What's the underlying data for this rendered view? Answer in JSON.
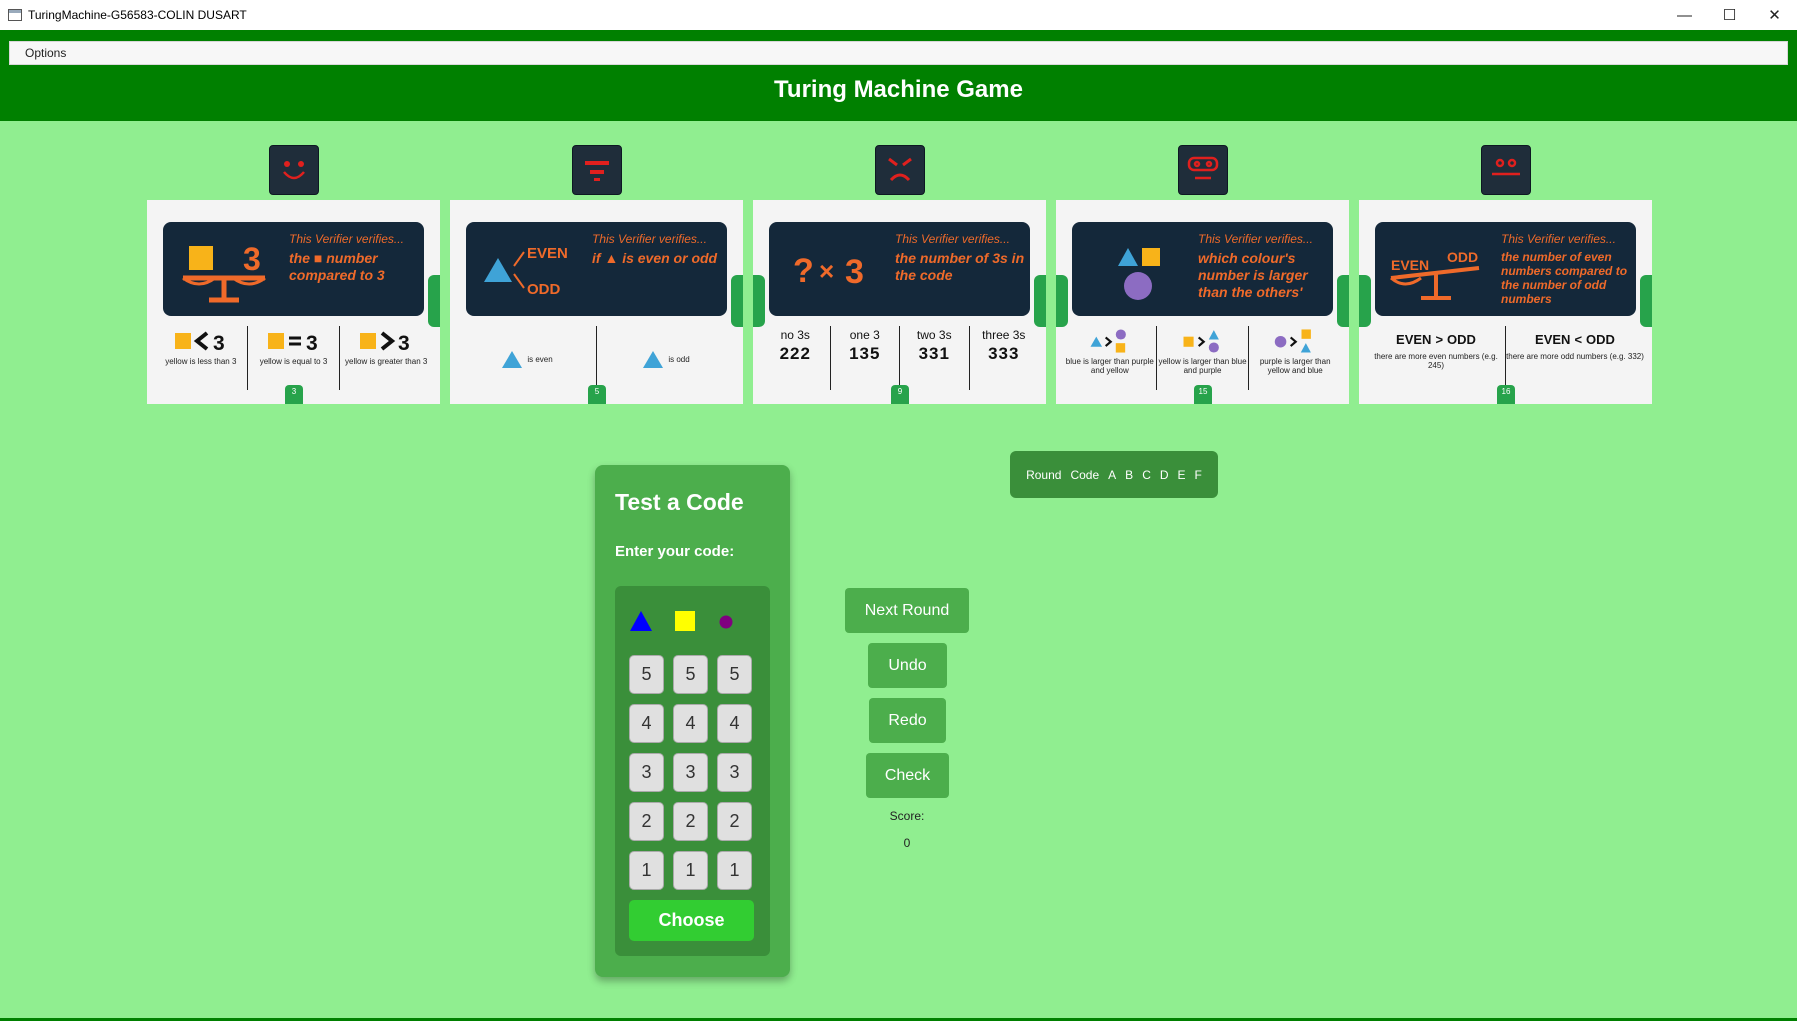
{
  "window": {
    "title": "TuringMachine-G56583-COLIN DUSART",
    "minimize": "—",
    "maximize": "☐",
    "close": "✕"
  },
  "menu": {
    "options": "Options"
  },
  "header": {
    "title": "Turing Machine Game"
  },
  "colors": {
    "accent": "#008000",
    "background": "#90ee90",
    "panel": "#4cae4c",
    "choose": "#32cd32",
    "card_text": "#ef6a2a"
  },
  "cards": [
    {
      "number": "3",
      "verifies": "This Verifier verifies...",
      "desc": "the ■ number compared to 3",
      "options": [
        {
          "caption": "yellow is less than 3"
        },
        {
          "caption": "yellow is equal to 3"
        },
        {
          "caption": "yellow is greater than 3"
        }
      ]
    },
    {
      "number": "5",
      "verifies": "This Verifier verifies...",
      "desc": "if ▲ is even or odd",
      "illus_even": "EVEN",
      "illus_odd": "ODD",
      "options": [
        {
          "caption": "is even"
        },
        {
          "caption": "is odd"
        }
      ]
    },
    {
      "number": "9",
      "verifies": "This Verifier verifies...",
      "desc": "the number of 3s in the code",
      "options": [
        {
          "top": "no 3s",
          "value": "222"
        },
        {
          "top": "one 3",
          "value": "135"
        },
        {
          "top": "two 3s",
          "value": "331"
        },
        {
          "top": "three 3s",
          "value": "333"
        }
      ]
    },
    {
      "number": "15",
      "verifies": "This Verifier verifies...",
      "desc": "which colour's number is larger than the others'",
      "options": [
        {
          "caption": "blue is larger than purple and yellow"
        },
        {
          "caption": "yellow is larger than blue and purple"
        },
        {
          "caption": "purple is larger than yellow and blue"
        }
      ]
    },
    {
      "number": "16",
      "verifies": "This Verifier verifies...",
      "desc": "the number of even numbers compared to the number of odd numbers",
      "illus_even": "EVEN",
      "illus_odd": "ODD",
      "options": [
        {
          "left": "EVEN",
          "right": "ODD",
          "caption": "there are more even numbers (e.g. 245)"
        },
        {
          "left": "EVEN",
          "right": "ODD",
          "caption": "there are more odd numbers (e.g. 332)"
        }
      ]
    }
  ],
  "round_panel": {
    "round": "Round",
    "code": "Code",
    "cols": [
      "A",
      "B",
      "C",
      "D",
      "E",
      "F"
    ]
  },
  "test_code": {
    "title": "Test a Code",
    "subtitle": "Enter your code:",
    "keys": [
      "5",
      "4",
      "3",
      "2",
      "1"
    ],
    "choose": "Choose"
  },
  "actions": {
    "next_round": "Next Round",
    "undo": "Undo",
    "redo": "Redo",
    "check": "Check",
    "score_label": "Score:",
    "score_value": "0"
  }
}
